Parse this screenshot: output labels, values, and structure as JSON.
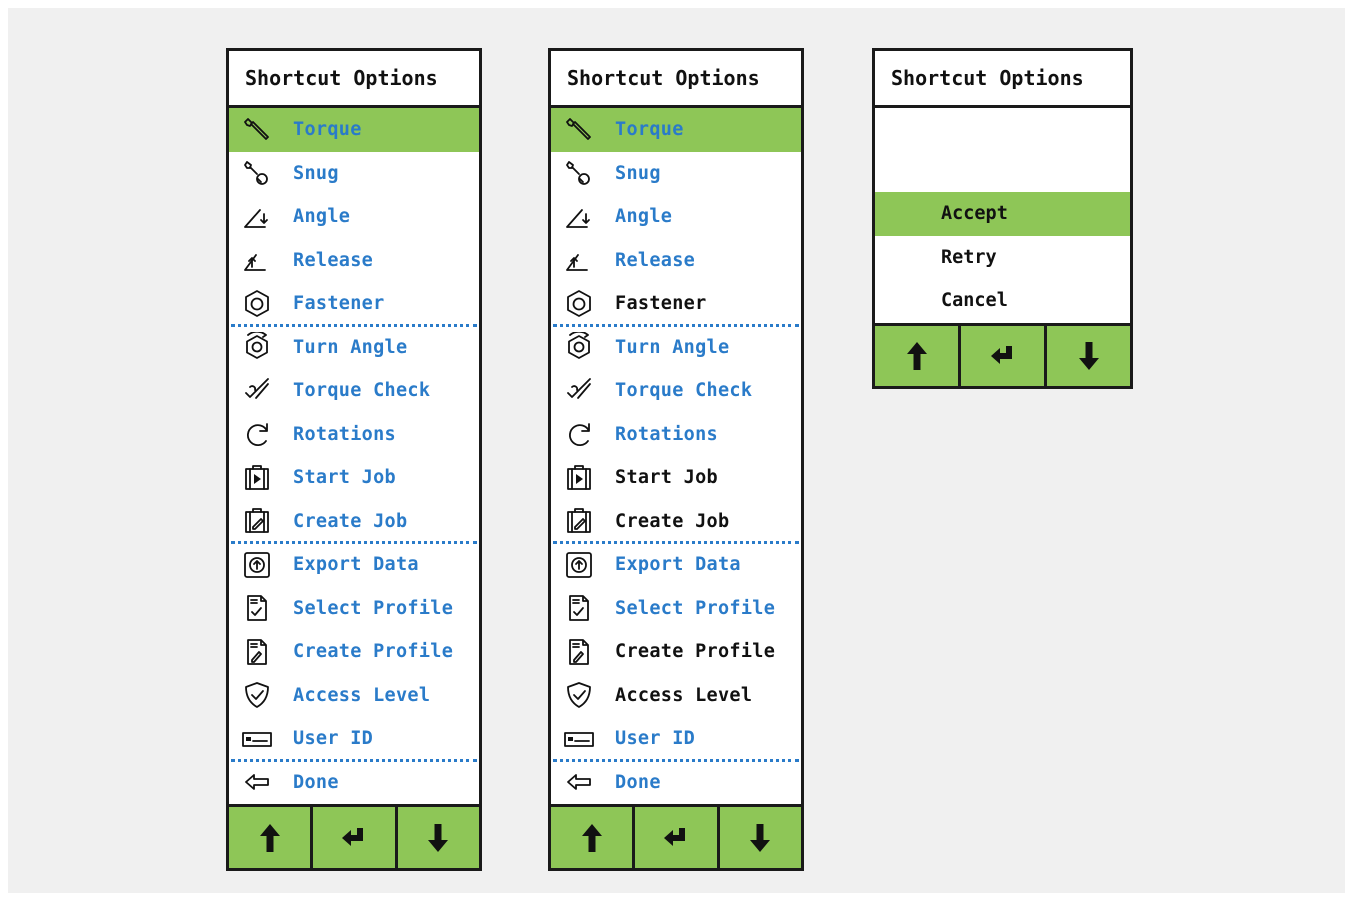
{
  "colors": {
    "accent_green": "#8ec657",
    "link_blue": "#2a7bc9",
    "text_dark": "#111111"
  },
  "panels": [
    {
      "title": "Shortcut Options",
      "items": [
        {
          "label": "Torque",
          "icon": "wrench-icon",
          "color": "blue",
          "selected": true
        },
        {
          "label": "Snug",
          "icon": "snug-wrench-icon",
          "color": "blue"
        },
        {
          "label": "Angle",
          "icon": "angle-icon",
          "color": "blue"
        },
        {
          "label": "Release",
          "icon": "release-angle-icon",
          "color": "blue"
        },
        {
          "label": "Fastener",
          "icon": "hex-nut-icon",
          "color": "blue",
          "sep": true
        },
        {
          "label": "Turn Angle",
          "icon": "turn-nut-icon",
          "color": "blue"
        },
        {
          "label": "Torque Check",
          "icon": "torque-check-icon",
          "color": "blue"
        },
        {
          "label": "Rotations",
          "icon": "rotation-icon",
          "color": "blue"
        },
        {
          "label": "Start Job",
          "icon": "start-job-icon",
          "color": "blue"
        },
        {
          "label": "Create Job",
          "icon": "create-job-icon",
          "color": "blue",
          "sep": true
        },
        {
          "label": "Export Data",
          "icon": "export-data-icon",
          "color": "blue"
        },
        {
          "label": "Select Profile",
          "icon": "select-profile-icon",
          "color": "blue"
        },
        {
          "label": "Create Profile",
          "icon": "create-profile-icon",
          "color": "blue"
        },
        {
          "label": "Access Level",
          "icon": "shield-check-icon",
          "color": "blue"
        },
        {
          "label": "User ID",
          "icon": "id-card-icon",
          "color": "blue",
          "sep": true
        },
        {
          "label": "Done",
          "icon": "back-arrow-icon",
          "color": "blue"
        }
      ],
      "nav": [
        "up-arrow-icon",
        "enter-icon",
        "down-arrow-icon"
      ]
    },
    {
      "title": "Shortcut Options",
      "items": [
        {
          "label": "Torque",
          "icon": "wrench-icon",
          "color": "blue",
          "selected": true
        },
        {
          "label": "Snug",
          "icon": "snug-wrench-icon",
          "color": "blue"
        },
        {
          "label": "Angle",
          "icon": "angle-icon",
          "color": "blue"
        },
        {
          "label": "Release",
          "icon": "release-angle-icon",
          "color": "blue"
        },
        {
          "label": "Fastener",
          "icon": "hex-nut-icon",
          "color": "dark",
          "sep": true
        },
        {
          "label": "Turn Angle",
          "icon": "turn-nut-icon",
          "color": "blue"
        },
        {
          "label": "Torque Check",
          "icon": "torque-check-icon",
          "color": "blue"
        },
        {
          "label": "Rotations",
          "icon": "rotation-icon",
          "color": "blue"
        },
        {
          "label": "Start Job",
          "icon": "start-job-icon",
          "color": "dark"
        },
        {
          "label": "Create Job",
          "icon": "create-job-icon",
          "color": "dark",
          "sep": true
        },
        {
          "label": "Export Data",
          "icon": "export-data-icon",
          "color": "blue"
        },
        {
          "label": "Select Profile",
          "icon": "select-profile-icon",
          "color": "blue"
        },
        {
          "label": "Create Profile",
          "icon": "create-profile-icon",
          "color": "dark"
        },
        {
          "label": "Access Level",
          "icon": "shield-check-icon",
          "color": "dark"
        },
        {
          "label": "User ID",
          "icon": "id-card-icon",
          "color": "blue",
          "sep": true
        },
        {
          "label": "Done",
          "icon": "back-arrow-icon",
          "color": "blue"
        }
      ],
      "nav": [
        "up-arrow-icon",
        "enter-icon",
        "down-arrow-icon"
      ]
    }
  ],
  "dialog": {
    "title": "Shortcut Options",
    "options": [
      {
        "label": "Accept",
        "selected": true
      },
      {
        "label": "Retry"
      },
      {
        "label": "Cancel"
      }
    ],
    "nav": [
      "up-arrow-icon",
      "enter-icon",
      "down-arrow-icon"
    ]
  }
}
